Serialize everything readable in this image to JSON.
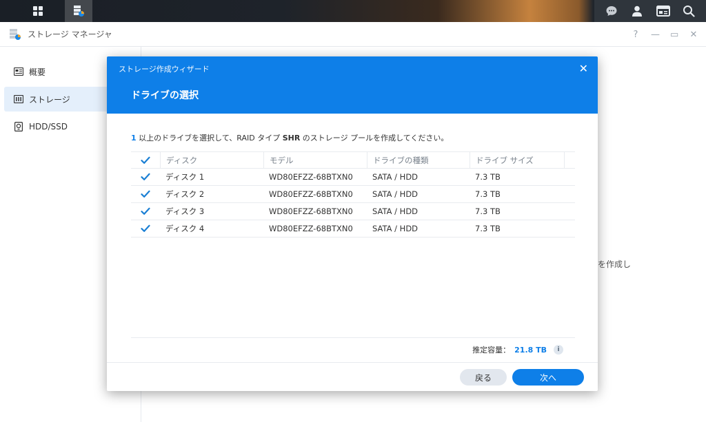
{
  "taskbar": {
    "left_buttons": [
      "main-menu-icon",
      "storage-manager-app-icon"
    ],
    "right_icons": [
      "chat-icon",
      "user-icon",
      "widgets-icon",
      "search-icon"
    ]
  },
  "app": {
    "title": "ストレージ マネージャ",
    "window_controls": [
      "?",
      "—",
      "▭",
      "✕"
    ]
  },
  "sidebar": {
    "items": [
      {
        "label": "概要",
        "icon": "overview-icon"
      },
      {
        "label": "ストレージ",
        "icon": "storage-icon",
        "active": true
      },
      {
        "label": "HDD/SSD",
        "icon": "hdd-icon"
      }
    ]
  },
  "background_text": "ルを作成し",
  "wizard": {
    "title": "ストレージ作成ウィザード",
    "close": "✕",
    "step_title": "ドライブの選択",
    "instruction": {
      "count": "1",
      "part1": " 以上のドライブを選択して、RAID タイプ ",
      "raid": "SHR",
      "part2": " のストレージ プールを作成してください。"
    },
    "table": {
      "headers": [
        "ディスク",
        "モデル",
        "ドライブの種類",
        "ドライブ サイズ"
      ],
      "rows": [
        {
          "disk": "ディスク 1",
          "model": "WD80EFZZ-68BTXN0",
          "type": "SATA / HDD",
          "size": "7.3 TB",
          "checked": true
        },
        {
          "disk": "ディスク 2",
          "model": "WD80EFZZ-68BTXN0",
          "type": "SATA / HDD",
          "size": "7.3 TB",
          "checked": true
        },
        {
          "disk": "ディスク 3",
          "model": "WD80EFZZ-68BTXN0",
          "type": "SATA / HDD",
          "size": "7.3 TB",
          "checked": true
        },
        {
          "disk": "ディスク 4",
          "model": "WD80EFZZ-68BTXN0",
          "type": "SATA / HDD",
          "size": "7.3 TB",
          "checked": true
        }
      ]
    },
    "capacity_label": "推定容量：",
    "capacity_value": "21.8 TB",
    "info": "i",
    "back_label": "戻る",
    "next_label": "次へ"
  },
  "colors": {
    "accent": "#0e7fe8",
    "check": "#1a7fd4"
  }
}
